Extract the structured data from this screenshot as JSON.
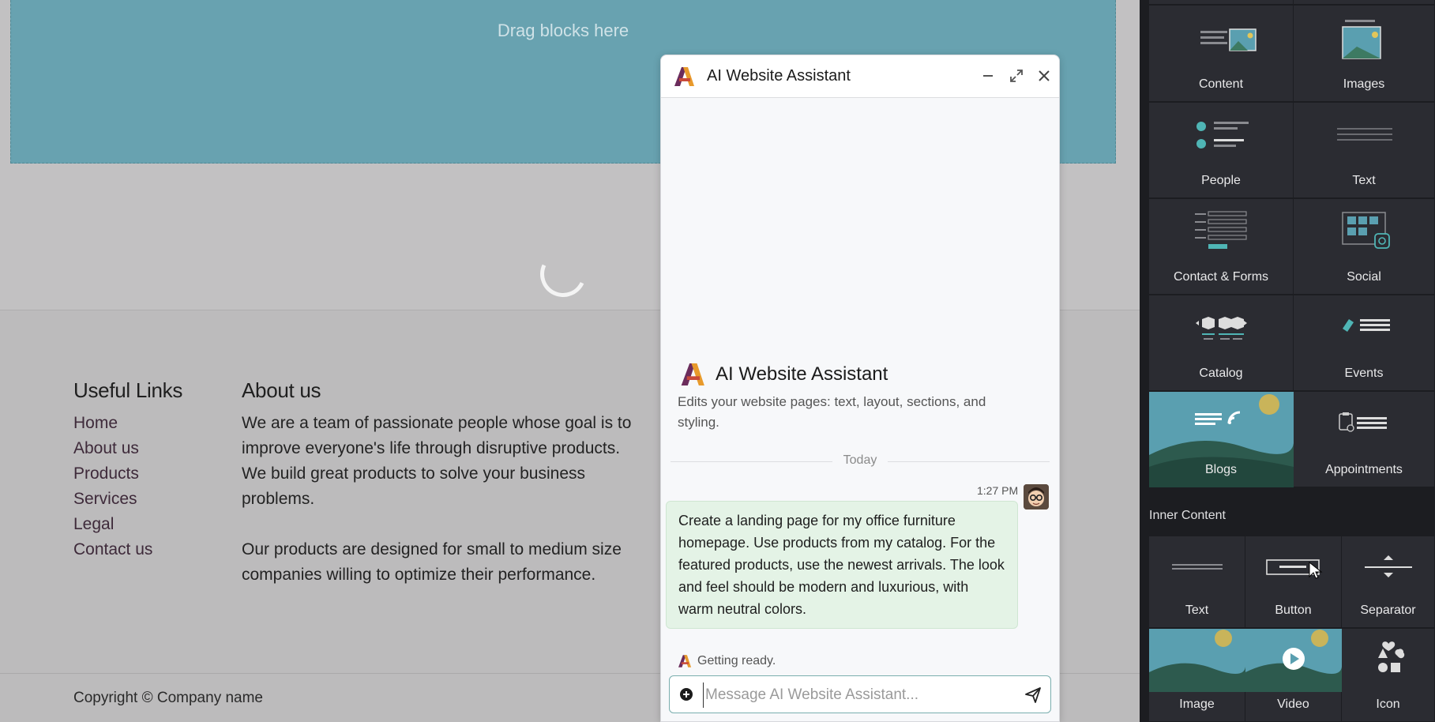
{
  "canvas": {
    "dropzone_text": "Drag blocks here",
    "useful_links": {
      "title": "Useful Links",
      "items": [
        "Home",
        "About us",
        "Products",
        "Services",
        "Legal",
        "Contact us"
      ]
    },
    "about": {
      "title": "About us",
      "paragraphs": [
        "We are a team of passionate people whose goal is to improve everyone's life through disruptive products. We build great products to solve your business problems.",
        "Our products are designed for small to medium size companies willing to optimize their performance."
      ]
    },
    "copyright": "Copyright © Company name"
  },
  "chat": {
    "title": "AI Website Assistant",
    "intro_title": "AI Website Assistant",
    "intro_description": "Edits your website pages: text, layout, sections, and styling.",
    "divider_label": "Today",
    "message": {
      "time": "1:27 PM",
      "text": "Create a landing page for my office furniture homepage. Use products from my catalog. For the featured products, use the newest arrivals. The look and feel should be modern and luxurious, with warm neutral colors."
    },
    "status": "Getting ready.",
    "composer_placeholder": "Message AI Website Assistant...",
    "composer_value": ""
  },
  "panel": {
    "blocks": [
      "Content",
      "Images",
      "People",
      "Text",
      "Contact & Forms",
      "Social",
      "Catalog",
      "Events",
      "Blogs",
      "Appointments"
    ],
    "inner_content_label": "Inner Content",
    "inner_blocks": [
      "Text",
      "Button",
      "Separator",
      "Image",
      "Video",
      "Icon"
    ]
  },
  "colors": {
    "dropzone": "#68a2b0",
    "panel_bg": "#1c1d21",
    "tile_bg": "#2b2c32",
    "accent_teal": "#4fb5b5",
    "message_bubble": "#e4f3e6"
  }
}
